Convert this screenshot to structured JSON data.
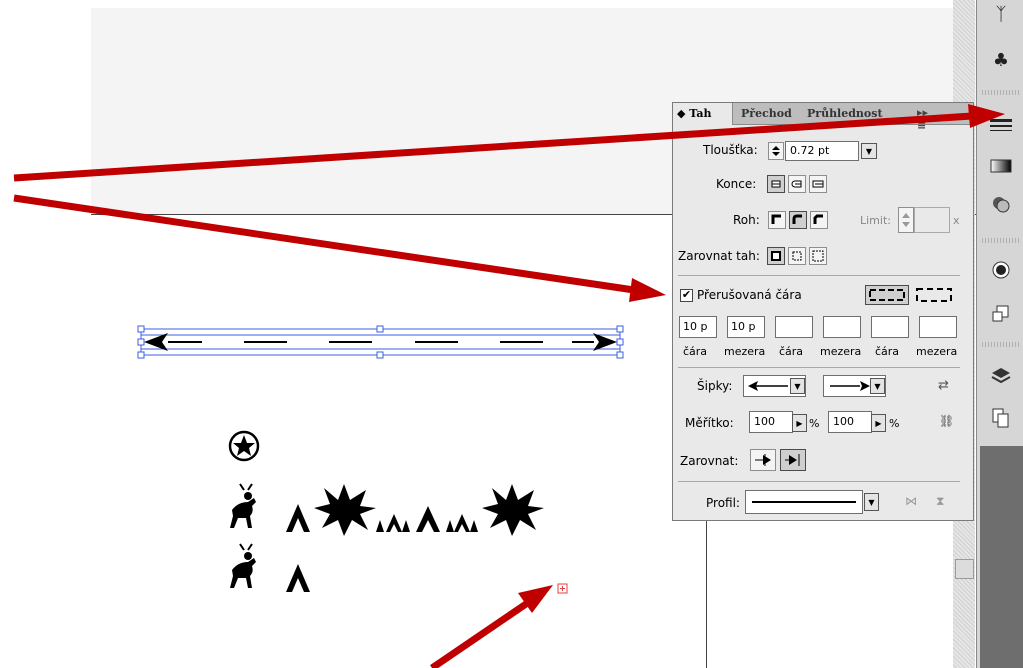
{
  "panel": {
    "tabs": [
      {
        "label": "◆ Tah"
      },
      {
        "label": "Přechod"
      },
      {
        "label": "Průhlednost"
      }
    ],
    "menu_icon": "▸▸ ≡",
    "weight": {
      "label": "Tloušťka:",
      "value": "0.72 pt"
    },
    "cap": {
      "label": "Konce:"
    },
    "corner": {
      "label": "Roh:",
      "limit_label": "Limit:",
      "limit_unit": "x"
    },
    "align": {
      "label": "Zarovnat tah:"
    },
    "dashed": {
      "label": "Přerušovaná čára",
      "checked": true
    },
    "dash_values": [
      "10 p",
      "10 p",
      "",
      "",
      "",
      ""
    ],
    "dash_labels": [
      "čára",
      "mezera",
      "čára",
      "mezera",
      "čára",
      "mezera"
    ],
    "arrows": {
      "label": "Šipky:"
    },
    "scale": {
      "label": "Měřítko:",
      "start": "100",
      "end": "100",
      "unit": "%"
    },
    "arrow_align": {
      "label": "Zarovnat:"
    },
    "profile": {
      "label": "Profil:"
    }
  },
  "dock_icons": [
    "symbol-icon",
    "club-icon",
    "stroke-icon",
    "gradient-icon",
    "transparency-icon",
    "appearance-icon",
    "graphic-styles-icon",
    "layers-icon",
    "artboards-icon"
  ],
  "colors": {
    "accent_arrow": "#c00000",
    "selection": "#3b5fe0"
  }
}
